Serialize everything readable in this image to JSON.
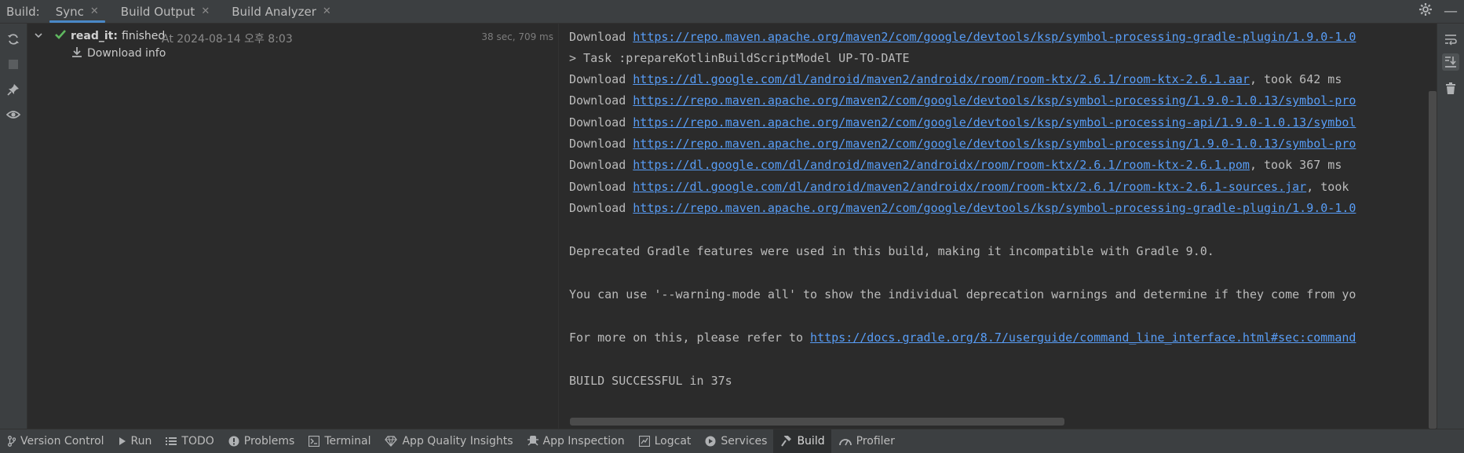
{
  "topbar": {
    "build_label": "Build:",
    "tabs": [
      {
        "label": "Sync"
      },
      {
        "label": "Build Output"
      },
      {
        "label": "Build Analyzer"
      }
    ],
    "close_glyph": "✕",
    "minimize_glyph": "—"
  },
  "tree": {
    "root": {
      "name": "read_it:",
      "status": "finished",
      "timestamp": "At 2024-08-14 오후 8:03",
      "duration": "38 sec, 709 ms"
    },
    "child": {
      "label": "Download info"
    }
  },
  "console": {
    "lines": [
      {
        "prefix": "Download ",
        "link": "https://repo.maven.apache.org/maven2/com/google/devtools/ksp/symbol-processing-gradle-plugin/1.9.0-1.0",
        "suffix": ""
      },
      {
        "prefix": "> Task :prepareKotlinBuildScriptModel UP-TO-DATE",
        "link": "",
        "suffix": ""
      },
      {
        "prefix": "Download ",
        "link": "https://dl.google.com/dl/android/maven2/androidx/room/room-ktx/2.6.1/room-ktx-2.6.1.aar",
        "suffix": ", took 642 ms"
      },
      {
        "prefix": "Download ",
        "link": "https://repo.maven.apache.org/maven2/com/google/devtools/ksp/symbol-processing/1.9.0-1.0.13/symbol-pro",
        "suffix": ""
      },
      {
        "prefix": "Download ",
        "link": "https://repo.maven.apache.org/maven2/com/google/devtools/ksp/symbol-processing-api/1.9.0-1.0.13/symbol",
        "suffix": ""
      },
      {
        "prefix": "Download ",
        "link": "https://repo.maven.apache.org/maven2/com/google/devtools/ksp/symbol-processing/1.9.0-1.0.13/symbol-pro",
        "suffix": ""
      },
      {
        "prefix": "Download ",
        "link": "https://dl.google.com/dl/android/maven2/androidx/room/room-ktx/2.6.1/room-ktx-2.6.1.pom",
        "suffix": ", took 367 ms"
      },
      {
        "prefix": "Download ",
        "link": "https://dl.google.com/dl/android/maven2/androidx/room/room-ktx/2.6.1/room-ktx-2.6.1-sources.jar",
        "suffix": ", took"
      },
      {
        "prefix": "Download ",
        "link": "https://repo.maven.apache.org/maven2/com/google/devtools/ksp/symbol-processing-gradle-plugin/1.9.0-1.0",
        "suffix": ""
      },
      {
        "prefix": "Deprecated Gradle features were used in this build, making it incompatible with Gradle 9.0.",
        "link": "",
        "suffix": ""
      },
      {
        "prefix": "You can use '--warning-mode all' to show the individual deprecation warnings and determine if they come from yo",
        "link": "",
        "suffix": ""
      },
      {
        "prefix": "For more on this, please refer to ",
        "link": "https://docs.gradle.org/8.7/userguide/command_line_interface.html#sec:command",
        "suffix": ""
      },
      {
        "prefix": "BUILD SUCCESSFUL in 37s",
        "link": "",
        "suffix": ""
      }
    ]
  },
  "bottombar": {
    "items": [
      {
        "label": "Version Control",
        "icon": "branch-icon"
      },
      {
        "label": "Run",
        "icon": "play-icon"
      },
      {
        "label": "TODO",
        "icon": "list-icon"
      },
      {
        "label": "Problems",
        "icon": "info-icon"
      },
      {
        "label": "Terminal",
        "icon": "terminal-icon"
      },
      {
        "label": "App Quality Insights",
        "icon": "diamond-icon"
      },
      {
        "label": "App Inspection",
        "icon": "inspect-icon"
      },
      {
        "label": "Logcat",
        "icon": "logcat-icon"
      },
      {
        "label": "Services",
        "icon": "services-icon"
      },
      {
        "label": "Build",
        "icon": "hammer-icon",
        "active": true
      },
      {
        "label": "Profiler",
        "icon": "gauge-icon"
      }
    ]
  },
  "colors": {
    "link": "#589df6",
    "success": "#5fb85f",
    "accent": "#4a88c7"
  }
}
